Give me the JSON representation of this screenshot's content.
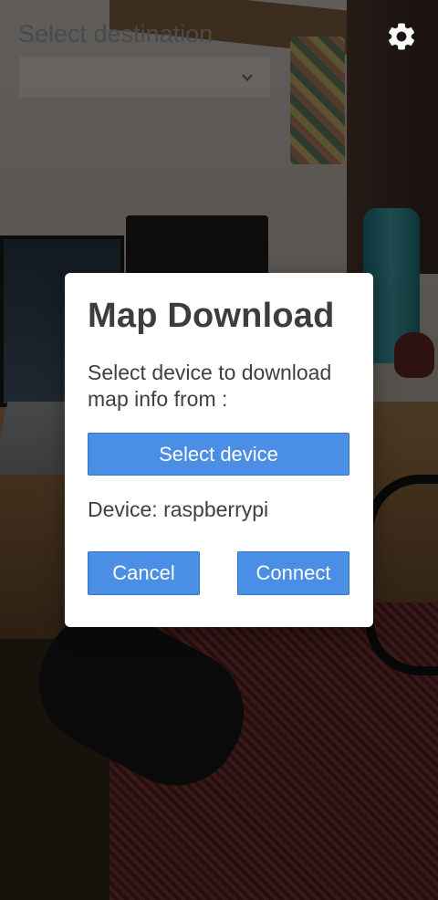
{
  "top_bar": {
    "destination_label": "Select destination",
    "destination_value": "",
    "settings_icon": "gear-icon",
    "chevron_icon": "chevron-down-icon"
  },
  "dialog": {
    "title": "Map Download",
    "message": "Select device to download map info from :",
    "select_device_label": "Select device",
    "device_prefix": "Device:",
    "device_name": "raspberrypi",
    "cancel_label": "Cancel",
    "connect_label": "Connect"
  },
  "colors": {
    "button_blue": "#4a8ee6",
    "dialog_bg": "#ffffff",
    "title_text": "#3d3d3d",
    "overlay": "rgba(0,0,0,0.58)"
  }
}
